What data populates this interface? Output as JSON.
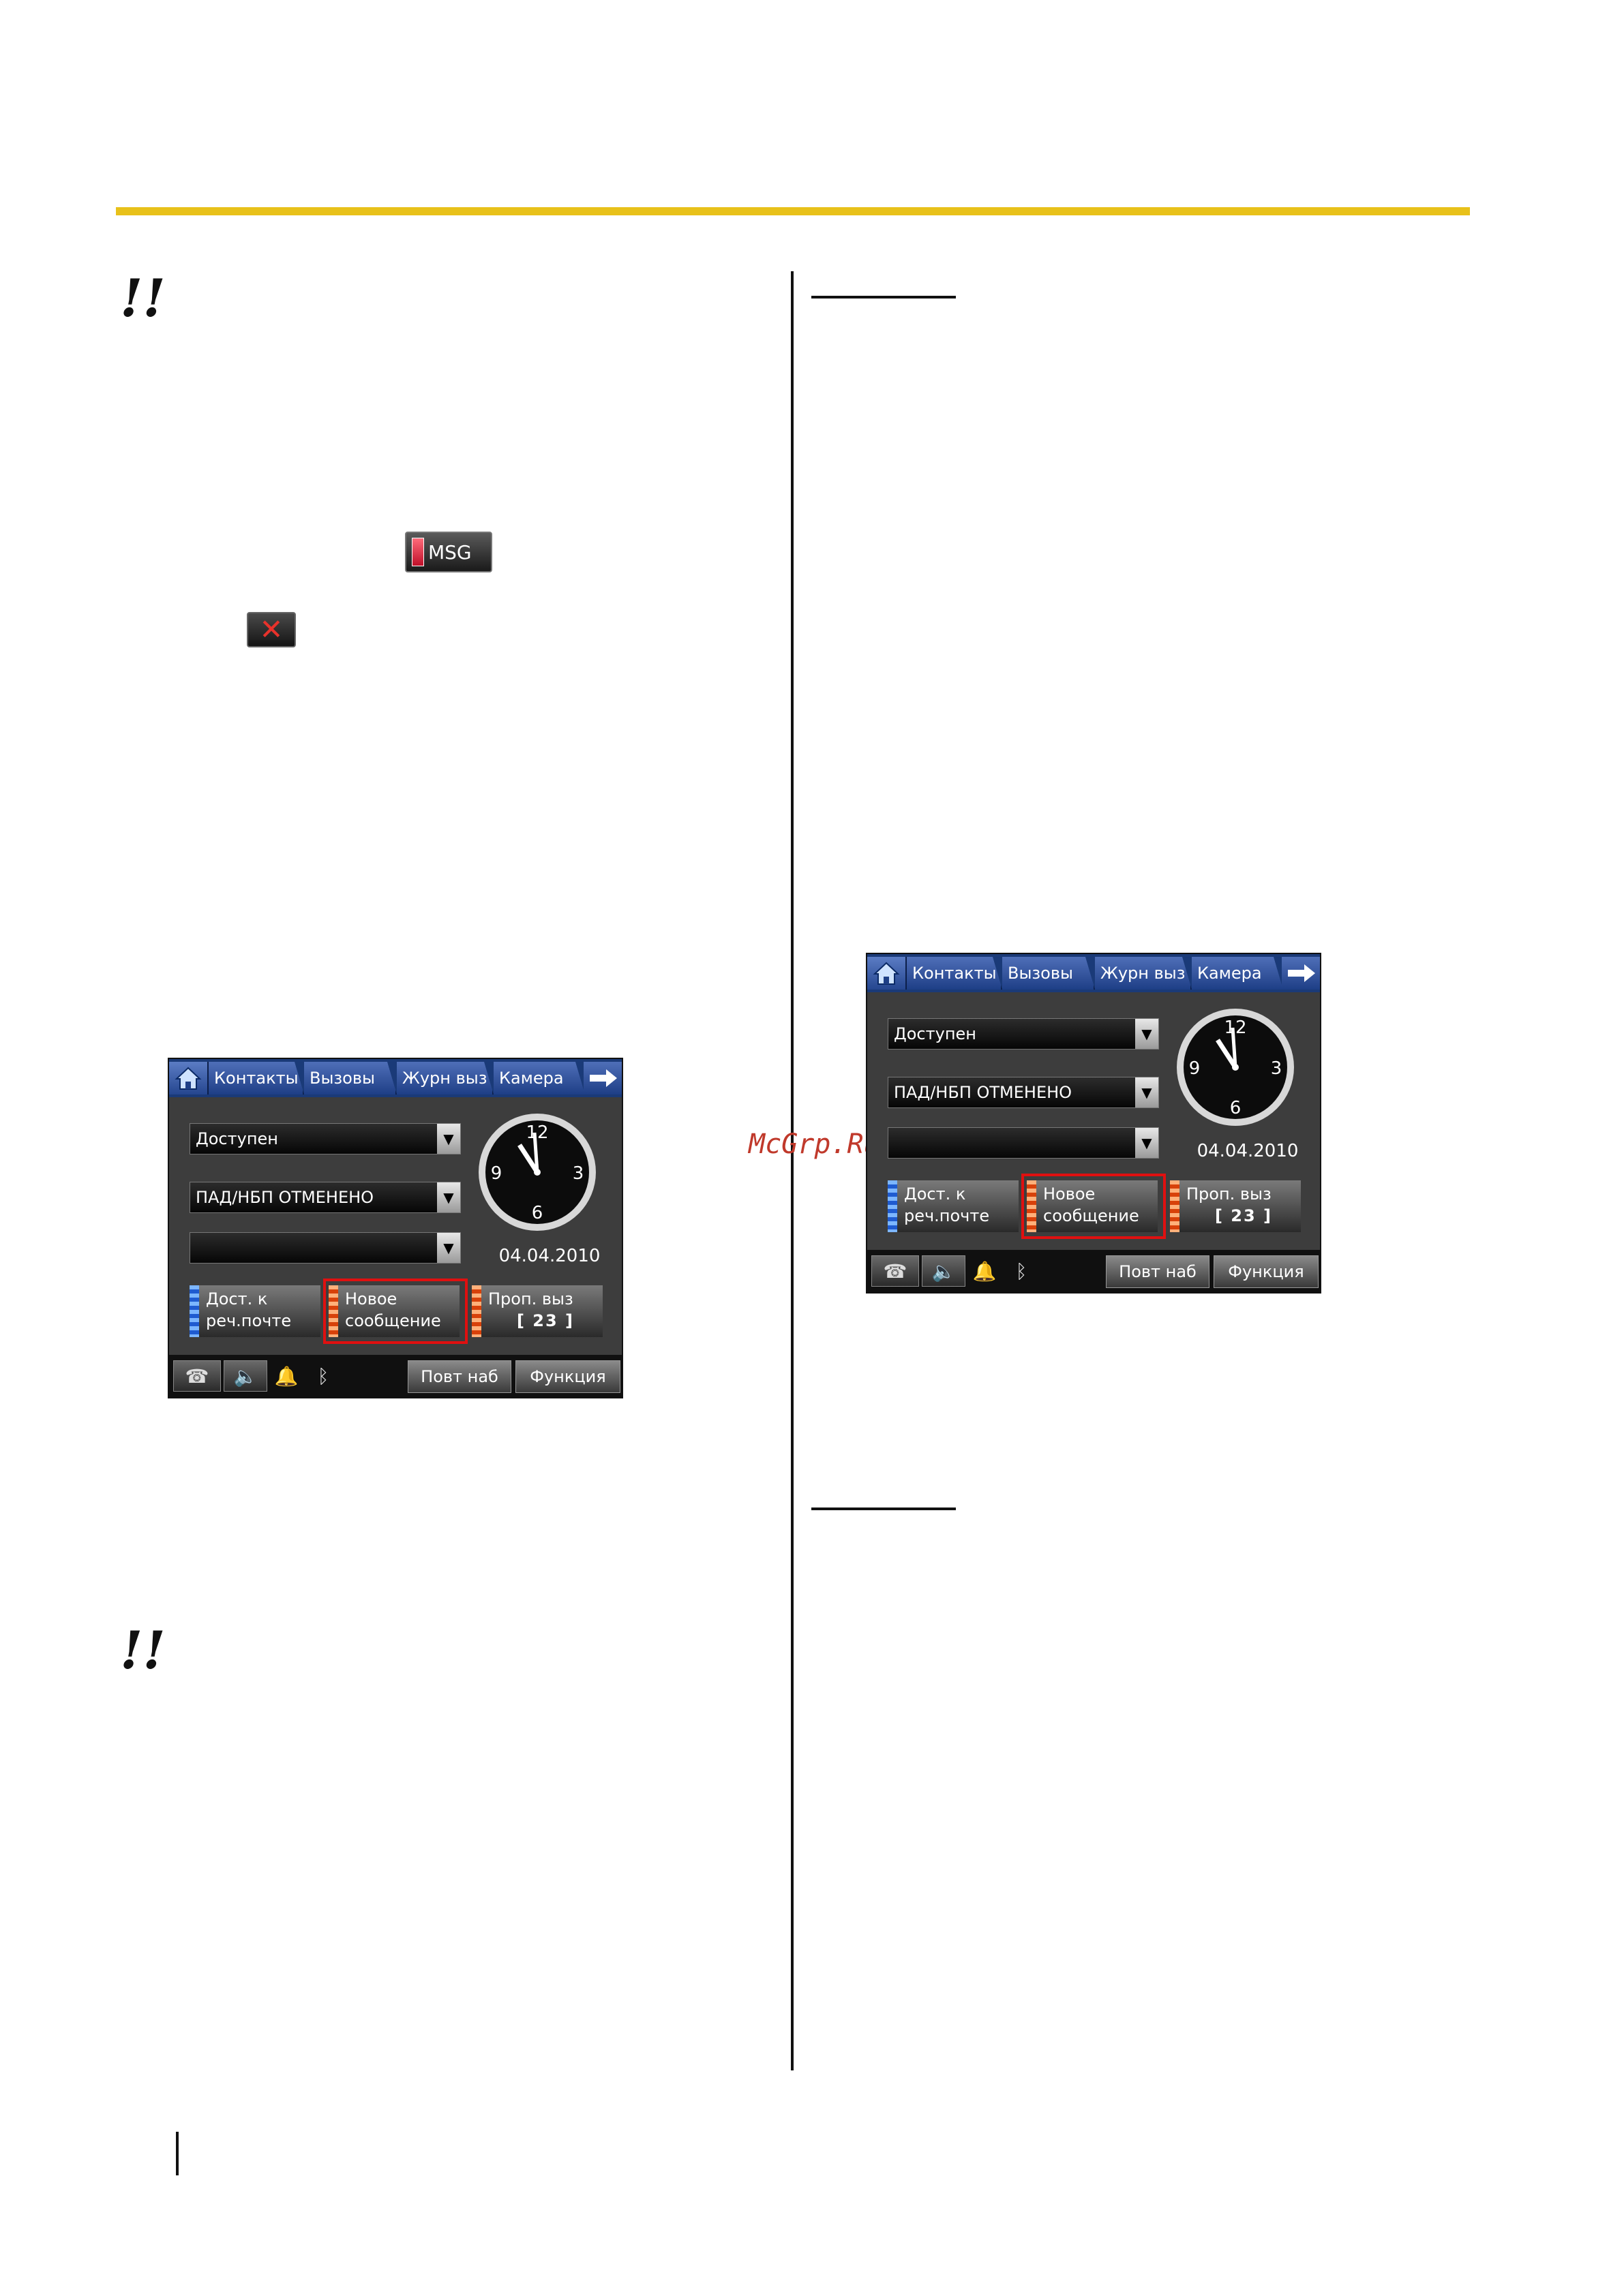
{
  "watermark": "McGrp.Ru",
  "warning_symbol": "!!",
  "icons": {
    "msg_label": "MSG",
    "close_glyph": "✕"
  },
  "phone": {
    "tabs": [
      "Контакты",
      "Вызовы",
      "Журн выз",
      "Камера"
    ],
    "dropdowns": [
      "Доступен",
      "ПАД/НБП ОТМЕНЕНО",
      ""
    ],
    "date": "04.04.2010",
    "clock_numbers": [
      "12",
      "3",
      "6",
      "9"
    ],
    "buttons": [
      {
        "top": "Дост. к",
        "bottom": "реч.почте"
      },
      {
        "top": "Новое",
        "bottom": "сообщение"
      },
      {
        "top": "Проп. выз",
        "bottom": "[ 23 ]"
      }
    ],
    "redial_label": "Повт наб",
    "function_label": "Функция"
  }
}
